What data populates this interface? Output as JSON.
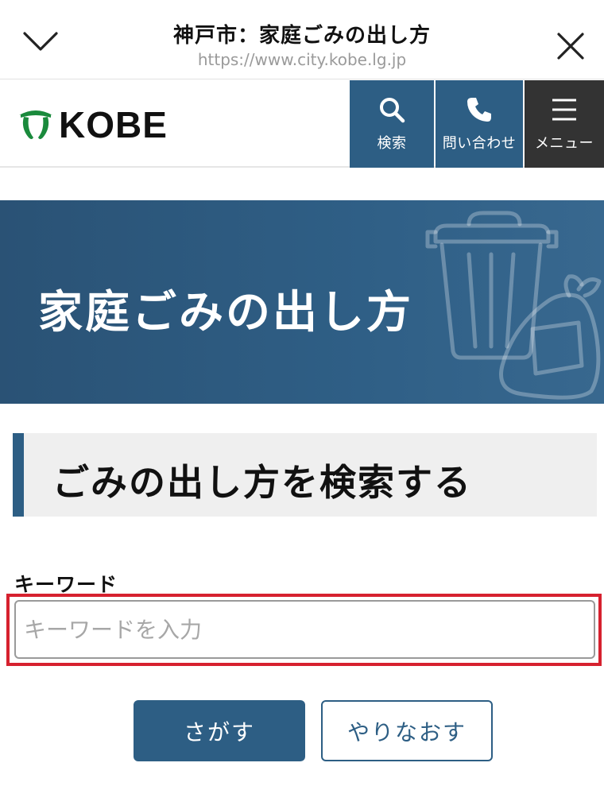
{
  "browser": {
    "title": "神戸市：家庭ごみの出し方",
    "url": "https://www.city.kobe.lg.jp"
  },
  "header": {
    "logo_text": "KOBE",
    "search_label": "検索",
    "contact_label": "問い合わせ",
    "menu_label": "メニュー"
  },
  "hero": {
    "title": "家庭ごみの出し方"
  },
  "section": {
    "heading": "ごみの出し方を検索する"
  },
  "form": {
    "keyword_label": "キーワード",
    "keyword_placeholder": "キーワードを入力",
    "keyword_value": "",
    "search_button": "さがす",
    "reset_button": "やりなおす"
  },
  "colors": {
    "brand_blue": "#2d5e84",
    "menu_dark": "#333333",
    "highlight_red": "#d6212f",
    "logo_green": "#1a8a3c"
  }
}
